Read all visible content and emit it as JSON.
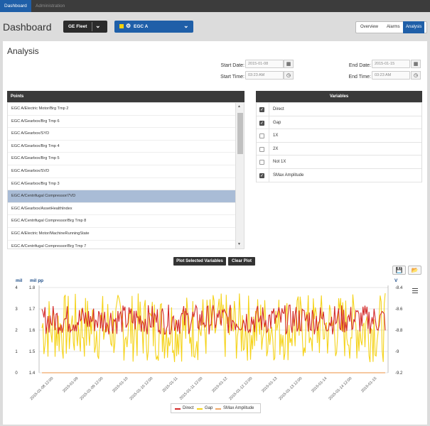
{
  "nav": {
    "tabs": [
      {
        "label": "Dashboard"
      },
      {
        "label": "Administration"
      }
    ]
  },
  "header": {
    "title": "Dashboard",
    "fleet_label": "GE Fleet",
    "asset_label": "EGC A",
    "view_tabs": [
      {
        "label": "Overview"
      },
      {
        "label": "Alarms"
      },
      {
        "label": "Analysis"
      }
    ]
  },
  "analysis": {
    "title": "Analysis",
    "start_date_label": "Start Date:",
    "start_date": "2015-01-08",
    "start_time_label": "Start Time:",
    "start_time": "03:23 AM",
    "end_date_label": "End Date:",
    "end_date": "2015-01-15",
    "end_time_label": "End Time:",
    "end_time": "03:23 AM"
  },
  "points": {
    "header": "Points",
    "items": [
      {
        "label": "EGC A/Electric Motor/Brg Tmp 2"
      },
      {
        "label": "EGC A/Gearbox/Brg Tmp 6"
      },
      {
        "label": "EGC A/Gearbox/SYD"
      },
      {
        "label": "EGC A/Gearbox/Brg Tmp 4"
      },
      {
        "label": "EGC A/Gearbox/Brg Tmp 5"
      },
      {
        "label": "EGC A/Gearbox/SVD"
      },
      {
        "label": "EGC A/Gearbox/Brg Tmp 3"
      },
      {
        "label": "EGC A/Centrifugal Compressor/7VD"
      },
      {
        "label": "EGC A/Gearbox/AssetHealthIndex"
      },
      {
        "label": "EGC A/Centrifugal Compressor/Brg Tmp 8"
      },
      {
        "label": "EGC A/Electric Motor/MachineRunningState"
      },
      {
        "label": "EGC A/Centrifugal Compressor/Brg Tmp 7"
      }
    ],
    "selected_index": 7
  },
  "variables": {
    "header": "Variables",
    "items": [
      {
        "label": "Direct",
        "checked": true
      },
      {
        "label": "Gap",
        "checked": true
      },
      {
        "label": "1X",
        "checked": false
      },
      {
        "label": "2X",
        "checked": false
      },
      {
        "label": "Not 1X",
        "checked": false
      },
      {
        "label": "SMax Amplitude",
        "checked": true
      }
    ]
  },
  "actions": {
    "plot_label": "Plot Selected Variables",
    "clear_label": "Clear Plot"
  },
  "colors": {
    "direct": "#d42a2a",
    "gap": "#f5d31a",
    "smax": "#f0a868",
    "brand": "#1f5fa8"
  },
  "chart_data": {
    "type": "line",
    "x_ticks": [
      "2015-01-08 12:00",
      "2015-01-09",
      "2015-01-09 12:00",
      "2015-01-10",
      "2015-01-10 12:00",
      "2015-01-11",
      "2015-01-11 12:00",
      "2015-01-12",
      "2015-01-12 12:00",
      "2015-01-13",
      "2015-01-13 12:00",
      "2015-01-14",
      "2015-01-14 12:00",
      "2015-01-15"
    ],
    "axes": {
      "mil": {
        "label": "mil",
        "ticks": [
          "4",
          "3",
          "2",
          "1",
          "0"
        ],
        "range": [
          0,
          4
        ]
      },
      "mil_pp": {
        "label": "mil pp",
        "ticks": [
          "1.8",
          "1.7",
          "1.6",
          "1.5",
          "1.4"
        ],
        "range": [
          1.4,
          1.8
        ]
      },
      "v": {
        "label": "V",
        "ticks": [
          "-8.4",
          "-8.6",
          "-8.8",
          "-9",
          "-9.2"
        ],
        "range": [
          -9.2,
          -8.4
        ]
      }
    },
    "series": [
      {
        "name": "Direct",
        "axis": "mil_pp",
        "band": [
          1.58,
          1.72
        ]
      },
      {
        "name": "Gap",
        "axis": "v",
        "band": [
          -9.1,
          -8.45
        ]
      },
      {
        "name": "SMax Amplitude",
        "axis": "mil",
        "value": 0
      }
    ]
  }
}
